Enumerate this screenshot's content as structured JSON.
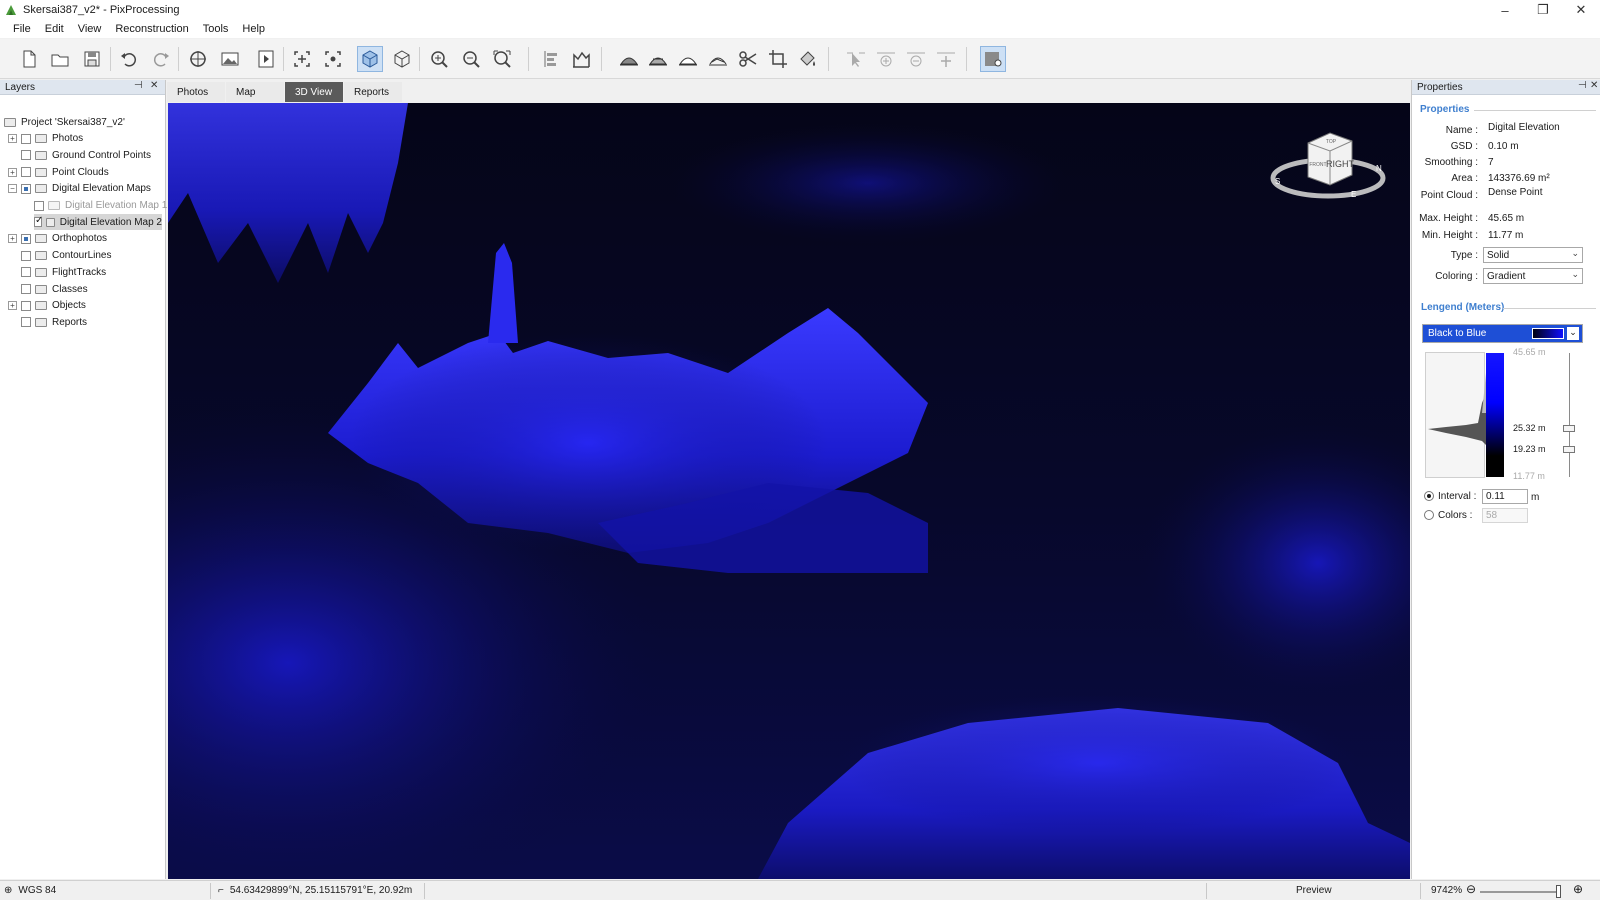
{
  "window": {
    "title": "Skersai387_v2* - PixProcessing",
    "controls": {
      "minimize": "–",
      "restore": "❐",
      "close": "✕"
    }
  },
  "menu": [
    "File",
    "Edit",
    "View",
    "Reconstruction",
    "Tools",
    "Help"
  ],
  "toolbar": {
    "buttons": [
      "new-file-icon",
      "open-folder-icon",
      "save-icon",
      "undo-icon",
      "redo-icon",
      "target-icon",
      "image-icon",
      "play-icon",
      "add-point-icon",
      "measure-point-icon",
      "cube-solid-icon",
      "cube-wire-icon",
      "zoom-in-icon",
      "zoom-out-icon",
      "zoom-fit-icon",
      "align-icon",
      "chart-icon",
      "terrain-1-icon",
      "terrain-2-icon",
      "terrain-3-icon",
      "terrain-4-icon",
      "scissors-icon",
      "crop-icon",
      "paint-icon",
      "select-arrow-icon",
      "add-node-icon",
      "remove-node-icon",
      "move-node-icon",
      "map-pin-icon"
    ]
  },
  "layers": {
    "title": "Layers",
    "items": [
      {
        "label": "Project 'Skersai387_v2'",
        "level": 0,
        "expander": "",
        "checkbox": "none"
      },
      {
        "label": "Photos",
        "level": 1,
        "expander": "+",
        "checkbox": "unchecked"
      },
      {
        "label": "Ground Control Points",
        "level": 1,
        "expander": "",
        "checkbox": "unchecked"
      },
      {
        "label": "Point Clouds",
        "level": 1,
        "expander": "+",
        "checkbox": "unchecked"
      },
      {
        "label": "Digital Elevation Maps",
        "level": 1,
        "expander": "−",
        "checkbox": "partial"
      },
      {
        "label": "Digital Elevation Map 1",
        "level": 2,
        "expander": "",
        "checkbox": "unchecked",
        "disabled": true
      },
      {
        "label": "Digital Elevation Map 2",
        "level": 2,
        "expander": "",
        "checkbox": "checked",
        "selected": true
      },
      {
        "label": "Orthophotos",
        "level": 1,
        "expander": "+",
        "checkbox": "partial"
      },
      {
        "label": "ContourLines",
        "level": 1,
        "expander": "",
        "checkbox": "unchecked"
      },
      {
        "label": "FlightTracks",
        "level": 1,
        "expander": "",
        "checkbox": "unchecked"
      },
      {
        "label": "Classes",
        "level": 1,
        "expander": "",
        "checkbox": "unchecked"
      },
      {
        "label": "Objects",
        "level": 1,
        "expander": "+",
        "checkbox": "unchecked"
      },
      {
        "label": "Reports",
        "level": 1,
        "expander": "",
        "checkbox": "unchecked"
      }
    ]
  },
  "tabs": [
    {
      "label": "Photos",
      "active": false
    },
    {
      "label": "Map",
      "active": false
    },
    {
      "label": "3D View",
      "active": true
    },
    {
      "label": "Reports",
      "active": false
    }
  ],
  "viewport": {
    "navcube_face": "RIGHT",
    "navcube_top": "TOP",
    "navcube_side": "FRONT",
    "compass_s": "S",
    "compass_n": "N",
    "compass_e": "E"
  },
  "properties": {
    "panel_title": "Properties",
    "section_title": "Properties",
    "name_label": "Name :",
    "name_value": "Digital Elevation",
    "gsd_label": "GSD :",
    "gsd_value": "0.10 m",
    "smoothing_label": "Smoothing :",
    "smoothing_value": "7",
    "area_label": "Area :",
    "area_value": "143376.69 m²",
    "pointcloud_label": "Point Cloud :",
    "pointcloud_value": "Dense Point",
    "maxh_label": "Max. Height :",
    "maxh_value": "45.65 m",
    "minh_label": "Min. Height :",
    "minh_value": "11.77 m",
    "type_label": "Type :",
    "type_value": "Solid",
    "coloring_label": "Coloring :",
    "coloring_value": "Gradient",
    "legend_title": "Lengend (Meters)",
    "palette": "Black to Blue",
    "legend_max": "45.65 m",
    "legend_upper": "25.32 m",
    "legend_lower": "19.23 m",
    "legend_min": "11.77 m",
    "interval_label": "Interval :",
    "interval_value": "0.11",
    "interval_unit": "m",
    "colors_label": "Colors :",
    "colors_value": "58",
    "interval_selected": true
  },
  "status": {
    "crs": "WGS 84",
    "coords": "54.63429899°N, 25.15115791°E, 20.92m",
    "mode": "Preview",
    "zoom": "9742%"
  },
  "colors": {
    "accent": "#3f7fcf",
    "terrain": "#1515ff",
    "viewport_bg": "#06061a"
  }
}
